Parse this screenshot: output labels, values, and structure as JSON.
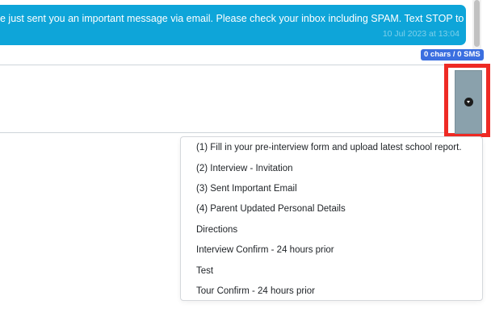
{
  "message": {
    "text": "e just sent you an important message via email. Please check your inbox including SPAM. Text STOP to opt-out.",
    "timestamp": "10 Jul 2023 at 13:04"
  },
  "composer": {
    "counter": "0 chars / 0 SMS",
    "value": ""
  },
  "template_toggle": {
    "icon": "caret-down-circle-icon"
  },
  "template_menu": {
    "items": [
      "(1) Fill in your pre-interview form and upload latest school report.",
      "(2) Interview - Invitation",
      "(3) Sent Important Email",
      "(4) Parent Updated Personal Details",
      "Directions",
      "Interview Confirm - 24 hours prior",
      "Test",
      "Tour Confirm - 24 hours prior"
    ]
  },
  "colors": {
    "bubble": "#0ea5d9",
    "badge": "#3b6fe0",
    "highlight": "#ee2a24",
    "toggle": "#8aa1ac"
  }
}
